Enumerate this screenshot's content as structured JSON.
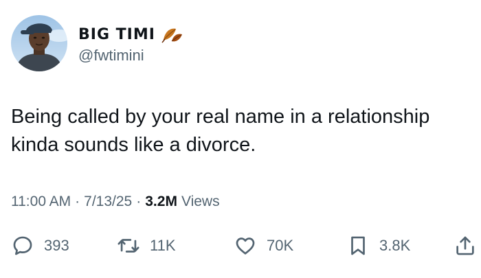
{
  "author": {
    "display_name": "BIG TIMI",
    "handle": "@fwtimini",
    "avatar_icon": "profile-photo",
    "name_emoji_icon": "fallen-leaf-icon"
  },
  "tweet": {
    "text": "Being called by your real name in a relationship kinda sounds like a divorce."
  },
  "meta": {
    "time": "11:00 AM",
    "separator": "·",
    "date": "7/13/25",
    "views_count": "3.2M",
    "views_label": "Views"
  },
  "actions": {
    "replies": "393",
    "retweets": "11K",
    "likes": "70K",
    "bookmarks": "3.8K"
  },
  "colors": {
    "text_primary": "#0f1419",
    "text_secondary": "#536471",
    "background": "#ffffff"
  }
}
